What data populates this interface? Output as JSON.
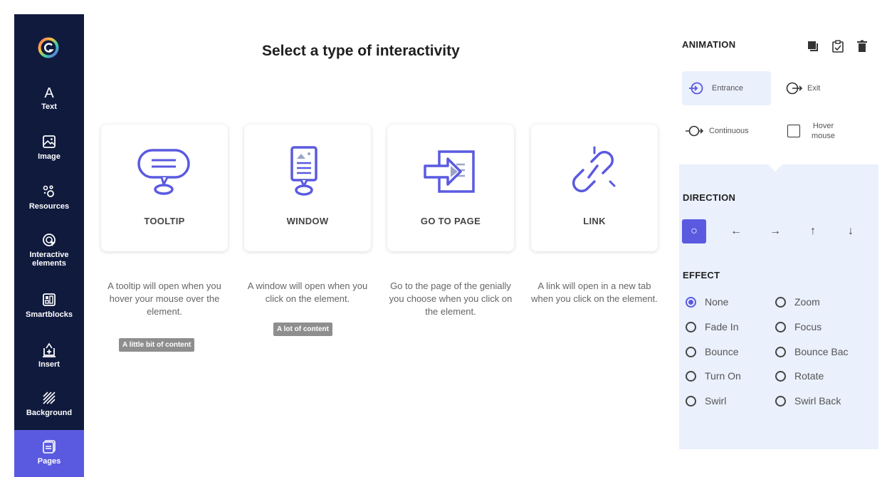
{
  "sidebar": {
    "items": [
      {
        "label": "Text",
        "icon": "text-icon"
      },
      {
        "label": "Image",
        "icon": "image-icon"
      },
      {
        "label": "Resources",
        "icon": "resources-icon"
      },
      {
        "label": "Interactive\nelements",
        "icon": "interactive-icon"
      },
      {
        "label": "Smartblocks",
        "icon": "smartblocks-icon"
      },
      {
        "label": "Insert",
        "icon": "insert-icon"
      },
      {
        "label": "Background",
        "icon": "background-icon"
      },
      {
        "label": "Pages",
        "icon": "pages-icon",
        "active": true
      }
    ],
    "colors": {
      "bg": "#101a3d",
      "active": "#5a5ae0"
    }
  },
  "main": {
    "title": "Select a type of interactivity",
    "cards": [
      {
        "label": "TOOLTIP",
        "description": "A tooltip will open when you hover your mouse over the element.",
        "badge": "A little bit of content"
      },
      {
        "label": "WINDOW",
        "description": "A window will open when you click on the element.",
        "badge": "A lot of content"
      },
      {
        "label": "GO TO PAGE",
        "description": "Go to the page of the genially you choose when you click on the element."
      },
      {
        "label": "LINK",
        "description": "A link will open in a new tab when you click on the element."
      }
    ]
  },
  "panel": {
    "animation_heading": "ANIMATION",
    "animation_options": {
      "entrance": "Entrance",
      "exit": "Exit",
      "continuous": "Continuous",
      "hover_mouse": "Hover\nmouse"
    },
    "direction_heading": "DIRECTION",
    "direction_buttons": [
      "○",
      "←",
      "→",
      "↑",
      "↓"
    ],
    "effect_heading": "EFFECT",
    "effects_left": [
      "None",
      "Fade In",
      "Bounce",
      "Turn On",
      "Swirl"
    ],
    "effects_right": [
      "Zoom",
      "Focus",
      "Bounce Bac",
      "Rotate",
      "Swirl Back"
    ],
    "selected_effect": "None",
    "accent_color": "#5a5ae0"
  }
}
